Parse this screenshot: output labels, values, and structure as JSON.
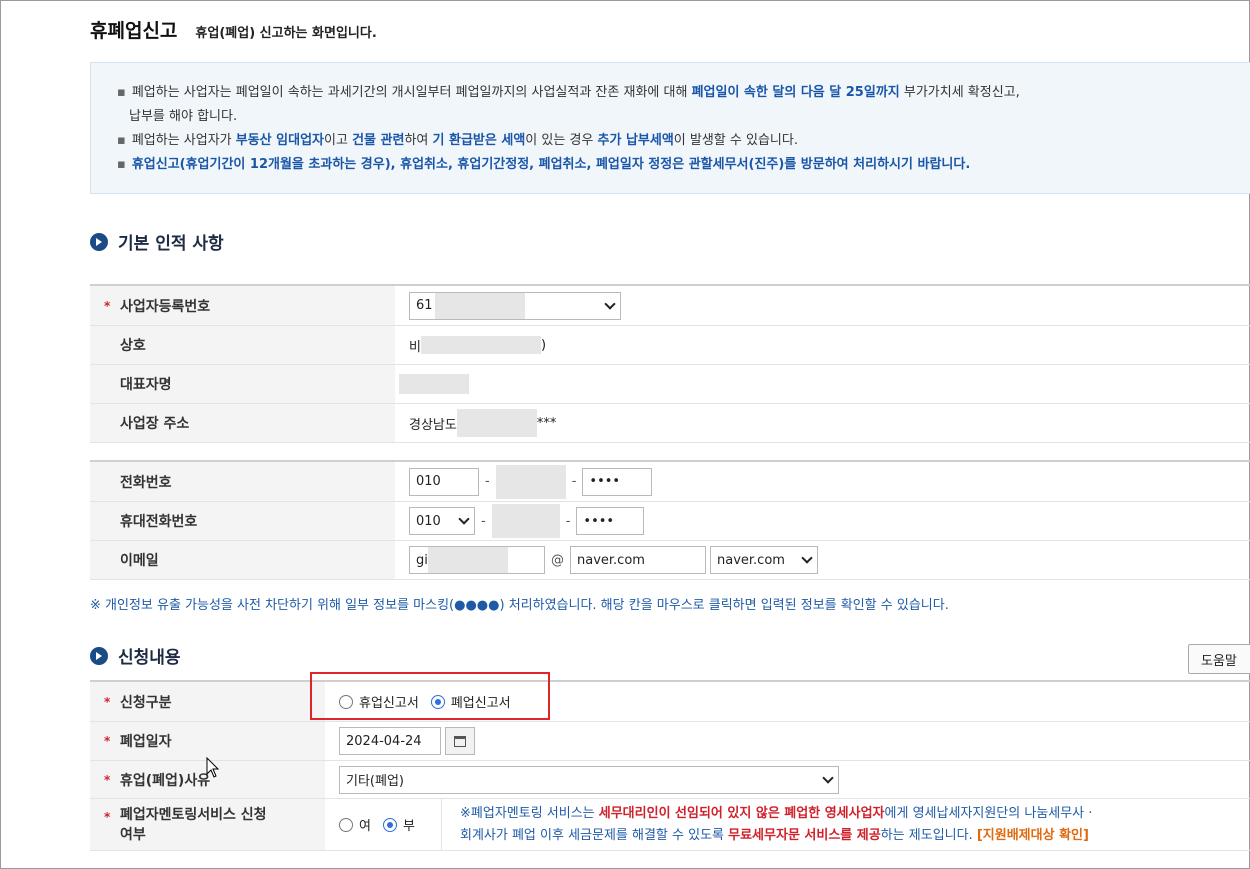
{
  "header": {
    "title": "휴폐업신고",
    "subtitle": "휴업(폐업) 신고하는 화면입니다."
  },
  "notice": {
    "line1_a": "폐업하는 사업자는 폐업일이 속하는 과세기간의 개시일부터 폐업일까지의 사업실적과 잔존 재화에 대해 ",
    "line1_b": "폐업일이 속한 달의 다음 달 25일까지",
    "line1_c": " 부가가치세 확정신고,",
    "line1_d": "납부를 해야 합니다.",
    "line2_a": "폐업하는 사업자가 ",
    "line2_b": "부동산 임대업자",
    "line2_c": "이고 ",
    "line2_d": "건물 관련",
    "line2_e": "하여 ",
    "line2_f": "기 환급받은 세액",
    "line2_g": "이 있는 경우 ",
    "line2_h": "추가 납부세액",
    "line2_i": "이 발생할 수 있습니다.",
    "line3": "휴업신고(휴업기간이 12개월을 초과하는 경우), 휴업취소, 휴업기간정정, 폐업취소, 폐업일자 정정은 관할세무서(진주)를 방문하여 처리하시기 바랍니다."
  },
  "basic": {
    "heading": "기본 인적 사항",
    "biz_no_label": "사업자등록번호",
    "biz_no_value": "61",
    "name_label": "상호",
    "name_value_a": "비",
    "name_value_b": ")",
    "rep_label": "대표자명",
    "addr_label": "사업장 주소",
    "addr_value_a": "경상남도",
    "addr_value_b": "***",
    "phone_label": "전화번호",
    "phone1": "010",
    "phone3": "••••",
    "mobile_label": "휴대전화번호",
    "mobile1": "010",
    "mobile3": "••••",
    "email_label": "이메일",
    "email_id": "gi",
    "email_at": "@",
    "email_domain": "naver.com",
    "email_domain_select": "naver.com",
    "dash": "-"
  },
  "privacy_note": "※ 개인정보 유출 가능성을 사전 차단하기 위해 일부 정보를 마스킹(●●●●) 처리하였습니다. 해당 칸을 마우스로 클릭하면 입력된 정보를 확인할 수 있습니다.",
  "apply": {
    "heading": "신청내용",
    "help_button": "도움말",
    "type_label": "신청구분",
    "type_opt1": "휴업신고서",
    "type_opt2": "폐업신고서",
    "type_selected": "폐업신고서",
    "date_label": "폐업일자",
    "date_value": "2024-04-24",
    "reason_label": "휴업(폐업)사유",
    "reason_value": "기타(폐업)",
    "mentor_label_a": "폐업자멘토링서비스 신청",
    "mentor_label_b": "여부",
    "mentor_yes": "여",
    "mentor_no": "부",
    "mentor_selected": "부",
    "mentor_a": "※폐업자멘토링 서비스는 ",
    "mentor_b": "세무대리인이 선임되어 있지 않은 폐업한 영세사업자",
    "mentor_c": "에게 영세납세자지원단의 나눔세무사 ·",
    "mentor_d": "회계사가 폐업 이후 세금문제를 해결할 수 있도록 ",
    "mentor_e": "무료세무자문 서비스를 제공",
    "mentor_f": "하는 제도입니다. ",
    "mentor_g": "[지원배제대상 확인]",
    "required_mark": "*"
  },
  "colors": {
    "accent_blue": "#1a56a8",
    "required_red": "#d0212a",
    "highlight_box": "#e0242a"
  }
}
